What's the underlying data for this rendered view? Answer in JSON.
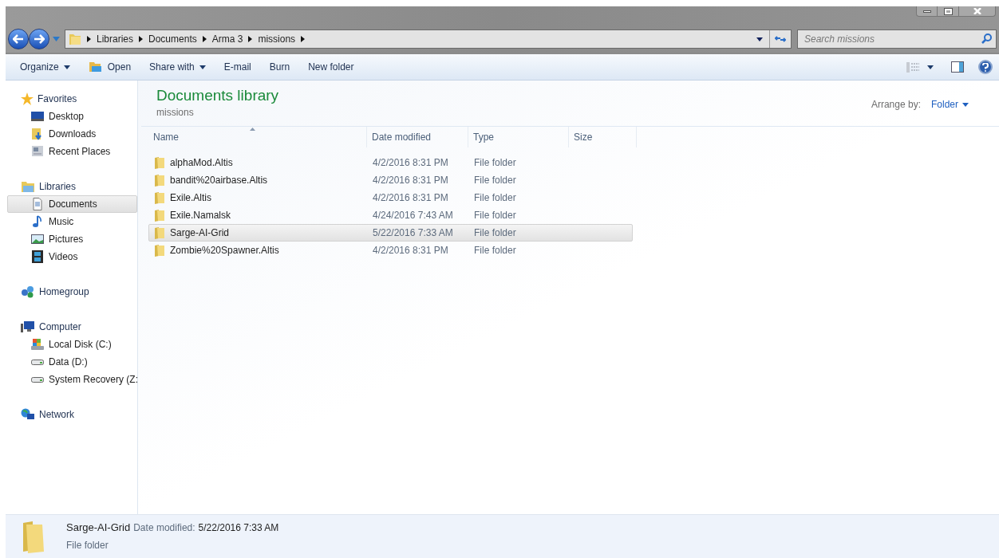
{
  "breadcrumb": [
    "Libraries",
    "Documents",
    "Arma 3",
    "missions"
  ],
  "search": {
    "placeholder": "Search missions"
  },
  "toolbar": [
    {
      "label": "Organize",
      "kind": "menu"
    },
    {
      "label": "Open",
      "kind": "icon"
    },
    {
      "label": "Share with",
      "kind": "menu"
    },
    {
      "label": "E-mail",
      "kind": "plain"
    },
    {
      "label": "Burn",
      "kind": "plain"
    },
    {
      "label": "New folder",
      "kind": "plain"
    }
  ],
  "sidebar": [
    {
      "label": "Favorites",
      "children": [
        {
          "label": "Desktop",
          "selected": false
        },
        {
          "label": "Downloads",
          "selected": false
        },
        {
          "label": "Recent Places",
          "selected": false
        }
      ]
    },
    {
      "label": "Libraries",
      "children": [
        {
          "label": "Documents",
          "selected": true
        },
        {
          "label": "Music",
          "selected": false
        },
        {
          "label": "Pictures",
          "selected": false
        },
        {
          "label": "Videos",
          "selected": false
        }
      ]
    },
    {
      "label": "Homegroup"
    },
    {
      "label": "Computer",
      "children": [
        {
          "label": "Local Disk (C:)",
          "selected": false
        },
        {
          "label": "Data (D:)",
          "selected": false
        },
        {
          "label": "System Recovery (Z:",
          "selected": false
        }
      ]
    },
    {
      "label": "Network"
    }
  ],
  "library": {
    "title": "Documents library",
    "subtitle": "missions",
    "arrange_label": "Arrange by:",
    "arrange_value": "Folder"
  },
  "table": {
    "columns": [
      "Name",
      "Date modified",
      "Type",
      "Size"
    ],
    "rows": [
      {
        "name": "alphaMod.Altis",
        "date": "4/2/2016 8:31 PM",
        "type": "File folder",
        "selected": false
      },
      {
        "name": "bandit%20airbase.Altis",
        "date": "4/2/2016 8:31 PM",
        "type": "File folder",
        "selected": false
      },
      {
        "name": "Exile.Altis",
        "date": "4/2/2016 8:31 PM",
        "type": "File folder",
        "selected": false
      },
      {
        "name": "Exile.Namalsk",
        "date": "4/24/2016 7:43 AM",
        "type": "File folder",
        "selected": false
      },
      {
        "name": "Sarge-AI-Grid",
        "date": "5/22/2016 7:33 AM",
        "type": "File folder",
        "selected": true
      },
      {
        "name": "Zombie%20Spawner.Altis",
        "date": "4/2/2016 8:31 PM",
        "type": "File folder",
        "selected": false
      }
    ]
  },
  "details": {
    "name": "Sarge-AI-Grid",
    "date_label": "Date modified:",
    "date": "5/22/2016 7:33 AM",
    "type": "File folder"
  }
}
